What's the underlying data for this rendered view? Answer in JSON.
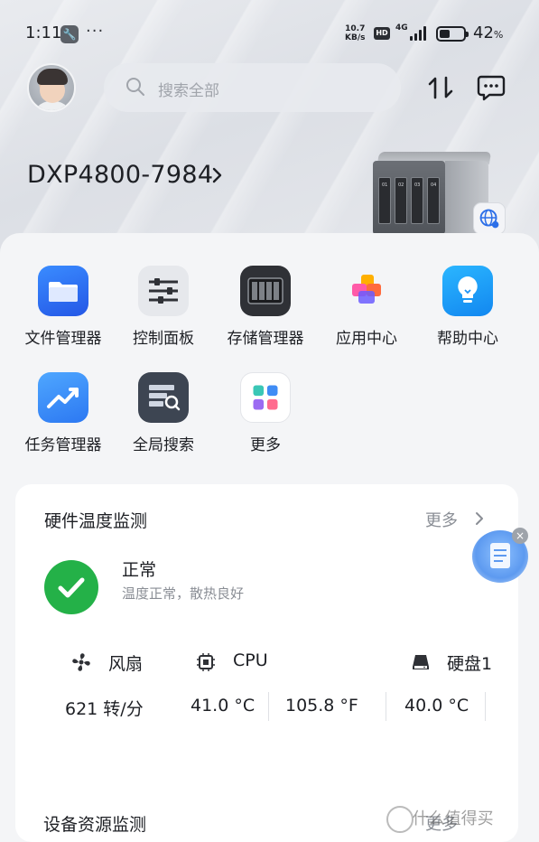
{
  "status_bar": {
    "time": "1:11",
    "net_speed_value": "10.7",
    "net_speed_unit": "KB/s",
    "hd": "HD",
    "signal_type": "4G",
    "battery_level": 0.42,
    "battery_pct": "42",
    "battery_pct_suffix": "%",
    "dots": "···"
  },
  "header": {
    "search_placeholder": "搜索全部"
  },
  "device": {
    "name": "DXP4800-7984",
    "bays": [
      "01",
      "02",
      "03",
      "04"
    ]
  },
  "apps": [
    {
      "label": "文件管理器",
      "icon": "folder-icon"
    },
    {
      "label": "控制面板",
      "icon": "sliders-icon"
    },
    {
      "label": "存储管理器",
      "icon": "storage-icon"
    },
    {
      "label": "应用中心",
      "icon": "app-center-icon"
    },
    {
      "label": "帮助中心",
      "icon": "lightbulb-icon"
    },
    {
      "label": "任务管理器",
      "icon": "trend-icon"
    },
    {
      "label": "全局搜索",
      "icon": "global-search-icon"
    },
    {
      "label": "更多",
      "icon": "grid-icon"
    }
  ],
  "hardware_card": {
    "title": "硬件温度监测",
    "more": "更多",
    "status_title": "正常",
    "status_desc": "温度正常，散热良好",
    "sensors": [
      {
        "name": "风扇",
        "icon": "fan-icon"
      },
      {
        "name": "CPU",
        "icon": "chip-icon"
      },
      {
        "name": "硬盘1",
        "icon": "disk-icon"
      }
    ],
    "values": {
      "fan": "621 转/分",
      "cpu_c": "41.0 °C",
      "cpu_f": "105.8 °F",
      "disk": "40.0 °C"
    }
  },
  "resource_section": {
    "title": "设备资源监测",
    "more": "更多"
  },
  "watermark": "什么值得买",
  "colors": {
    "accent_green": "#24b148",
    "brand_blue": "#2c78f2"
  }
}
